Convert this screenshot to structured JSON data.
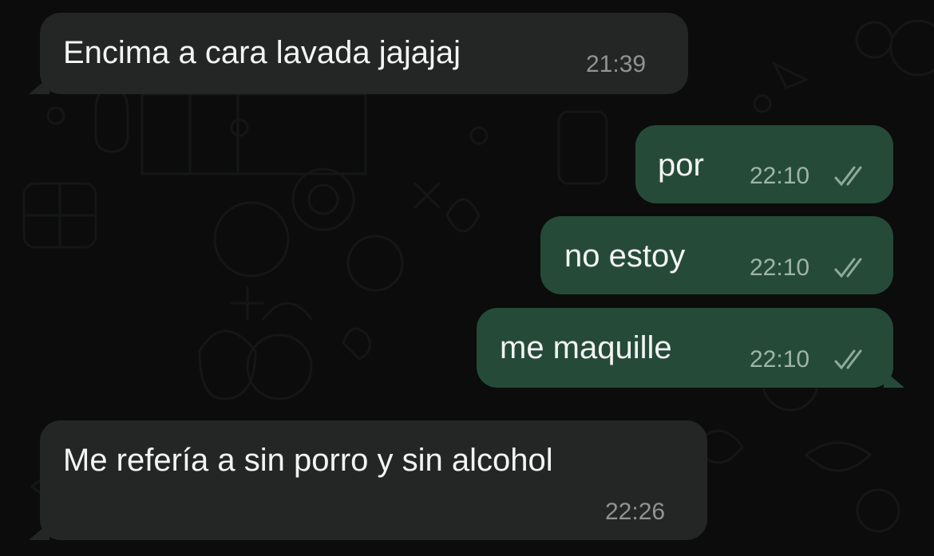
{
  "messages": [
    {
      "direction": "incoming",
      "text": "Encima a cara lavada jajajaj",
      "time": "21:39"
    },
    {
      "direction": "outgoing",
      "text": "por",
      "time": "22:10",
      "status_icon": "double-check-icon"
    },
    {
      "direction": "outgoing",
      "text": "no estoy",
      "time": "22:10",
      "status_icon": "double-check-icon"
    },
    {
      "direction": "outgoing",
      "text": "me maquille",
      "time": "22:10",
      "status_icon": "double-check-icon"
    },
    {
      "direction": "incoming",
      "text": "Me refería a sin porro y sin alcohol",
      "time": "22:26"
    }
  ],
  "colors": {
    "background": "#0c0c0c",
    "incoming_bubble": "#242626",
    "outgoing_bubble": "#254b38",
    "message_text": "#f4f4f4",
    "timestamp": "#8e9493"
  }
}
